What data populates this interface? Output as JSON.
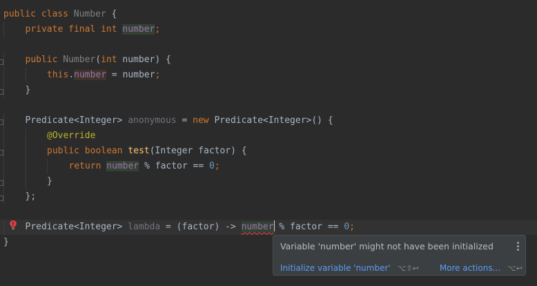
{
  "code": {
    "line1": {
      "public": "public",
      "class": "class",
      "name": "Number",
      "brace": " {"
    },
    "line2": {
      "private": "private",
      "final": "final",
      "int": "int",
      "field": "number",
      "semi": ";"
    },
    "line4": {
      "public": "public",
      "ctor": "Number",
      "paren_open": "(",
      "int": "int",
      "param": " number",
      "rest": ") {"
    },
    "line5": {
      "this": "this",
      "dot": ".",
      "field": "number",
      "assign": " = number",
      "semi": ";"
    },
    "line6": {
      "brace": "}"
    },
    "line8": {
      "type": "Predicate<Integer> ",
      "var": "anonymous",
      "eq": " = ",
      "new": "new",
      "rest": " Predicate<Integer>() {"
    },
    "line9": {
      "annotation": "@Override"
    },
    "line10": {
      "public": "public",
      "boolean": "boolean",
      "method": "test",
      "rest": "(Integer factor) {"
    },
    "line11": {
      "return": "return",
      "field": "number",
      "rest": " % factor == ",
      "zero": "0",
      "semi": ";"
    },
    "line12": {
      "brace": "}"
    },
    "line13": {
      "brace": "};"
    },
    "line15": {
      "type": "Predicate<Integer> ",
      "var": "lambda",
      "eq": " = (factor) -> ",
      "field": "number",
      "rest": " % factor == ",
      "zero": "0",
      "semi": ";"
    },
    "line16": {
      "brace": "}"
    }
  },
  "gutter": {
    "error_icon": "error-bulb-icon"
  },
  "popup": {
    "message": "Variable 'number' might not have been initialized",
    "action_primary": "Initialize variable 'number'",
    "action_primary_shortcut": "⌥⇧↩",
    "action_more": "More actions...",
    "action_more_shortcut": "⌥↩"
  },
  "colors": {
    "background": "#2b2b2b",
    "keyword": "#cc7832",
    "field": "#9876aa",
    "number": "#6897bb",
    "annotation": "#bbb529",
    "method": "#ffc66d",
    "error": "#bc3f3c",
    "link": "#589df6"
  }
}
